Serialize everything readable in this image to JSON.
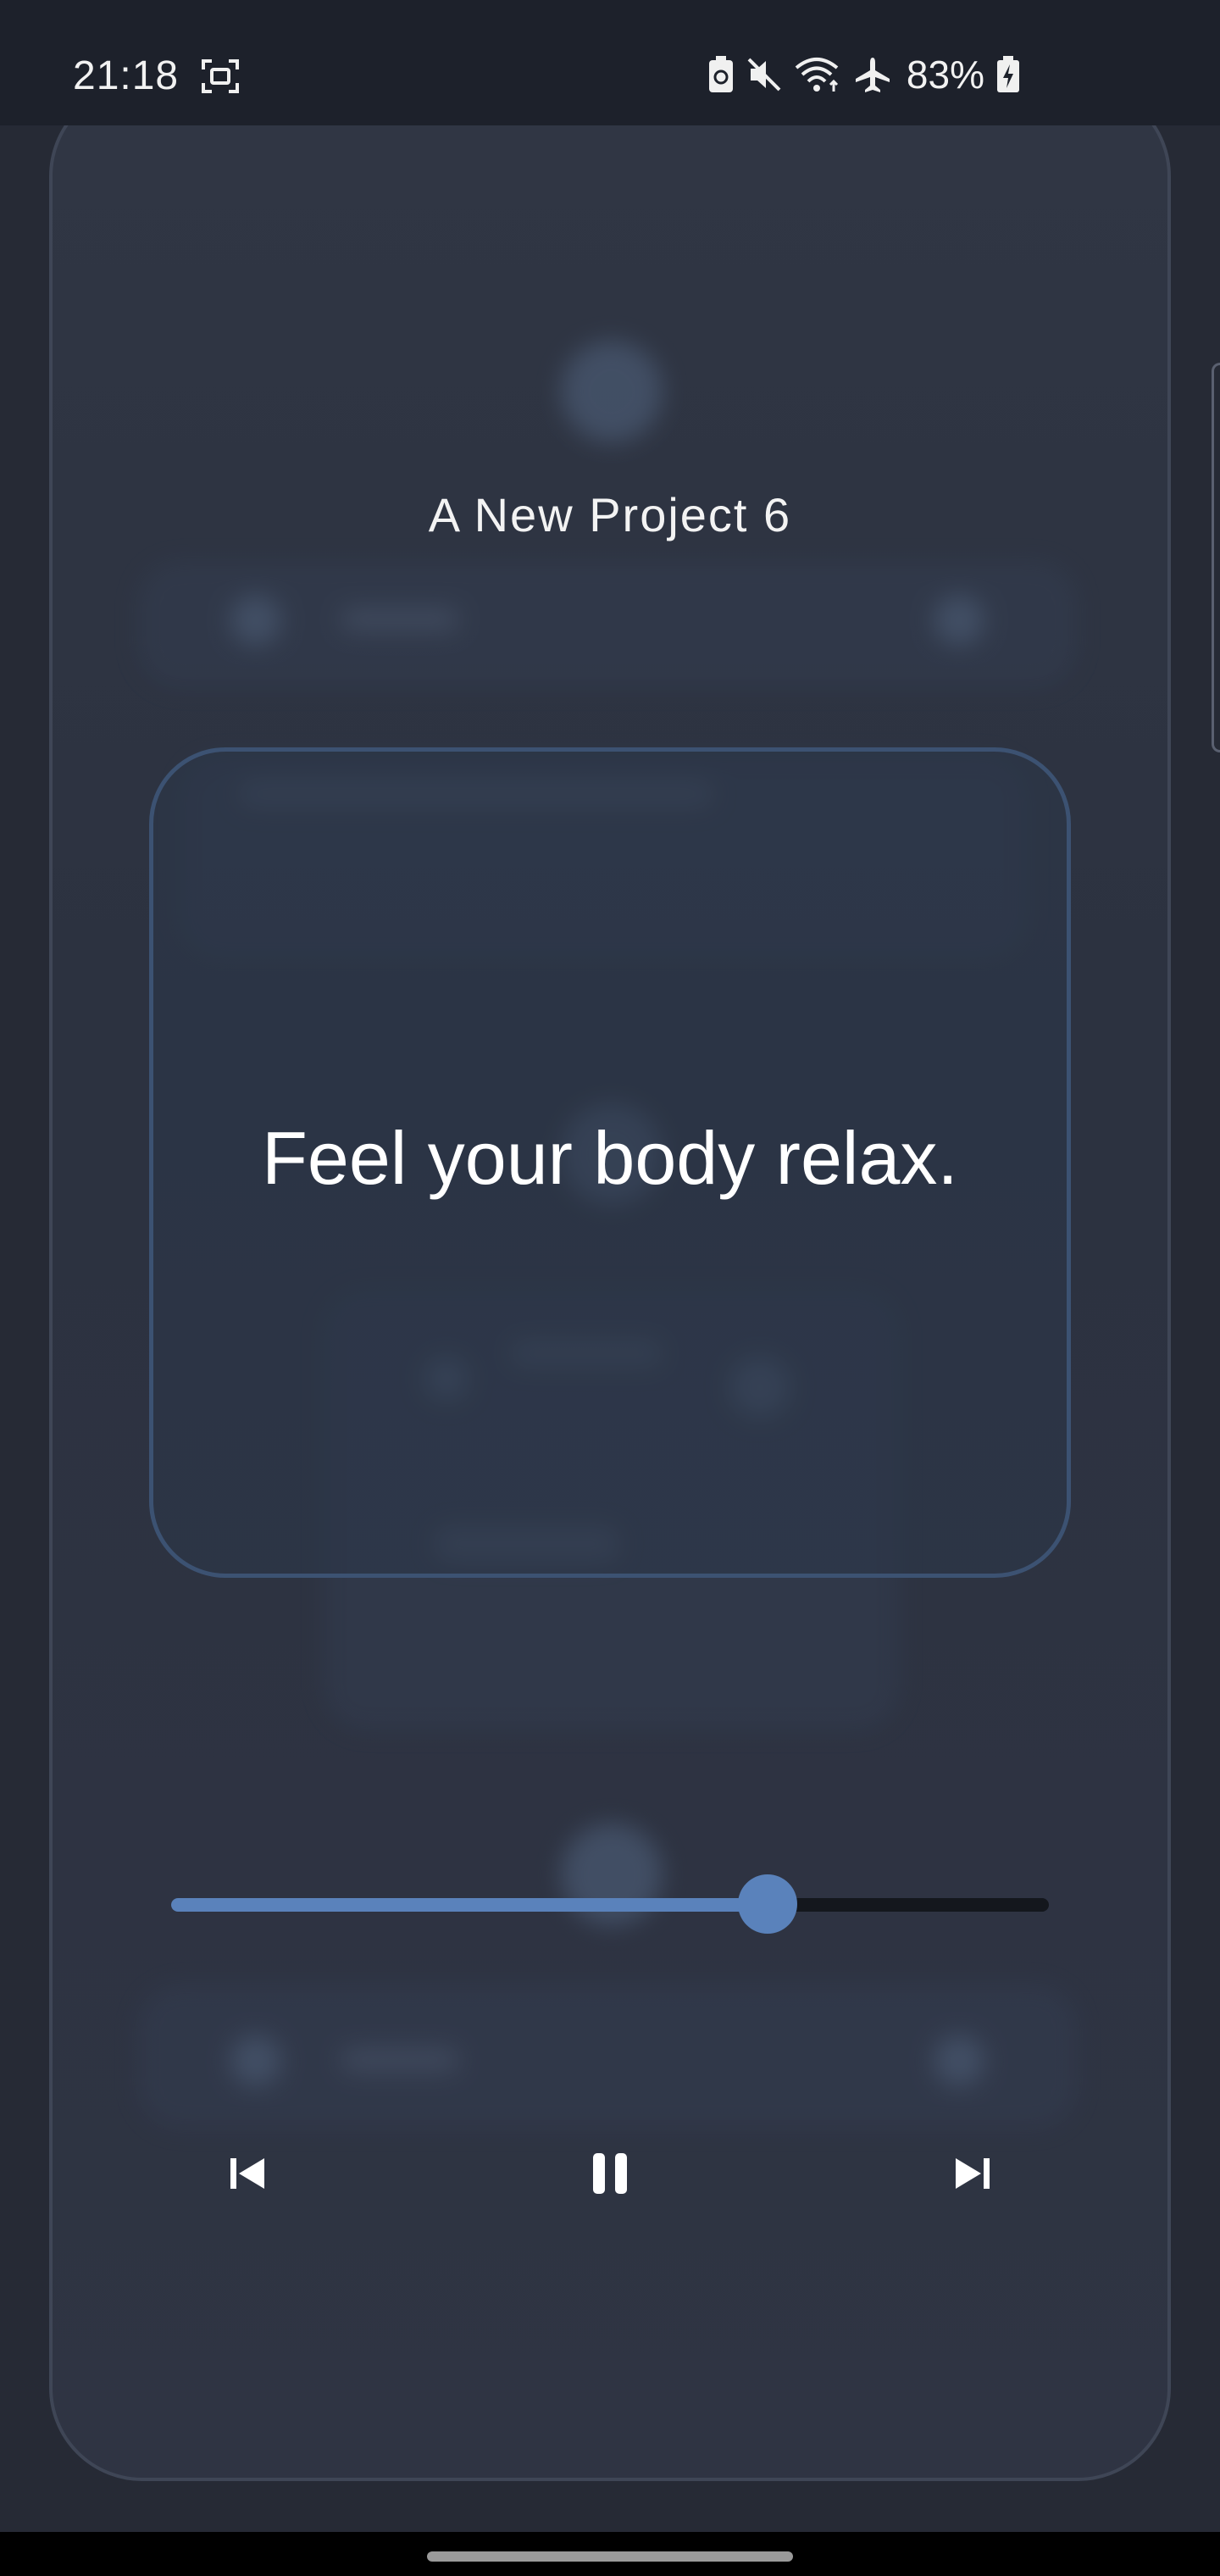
{
  "status_bar": {
    "time": "21:18",
    "battery_percent": "83%",
    "icons": [
      "screenshot-icon",
      "battery-saver-icon",
      "mute-icon",
      "wifi-icon",
      "airplane-icon",
      "battery-charging-icon"
    ]
  },
  "player": {
    "project_title": "A New Project 6",
    "message": "Feel your body relax.",
    "progress": 0.68,
    "controls": [
      "skip-previous-icon",
      "pause-icon",
      "skip-next-icon"
    ]
  },
  "colors": {
    "accent": "#5a82bb",
    "background": "#262a35",
    "card": "#2e3442",
    "card_border": "#3c5272"
  }
}
